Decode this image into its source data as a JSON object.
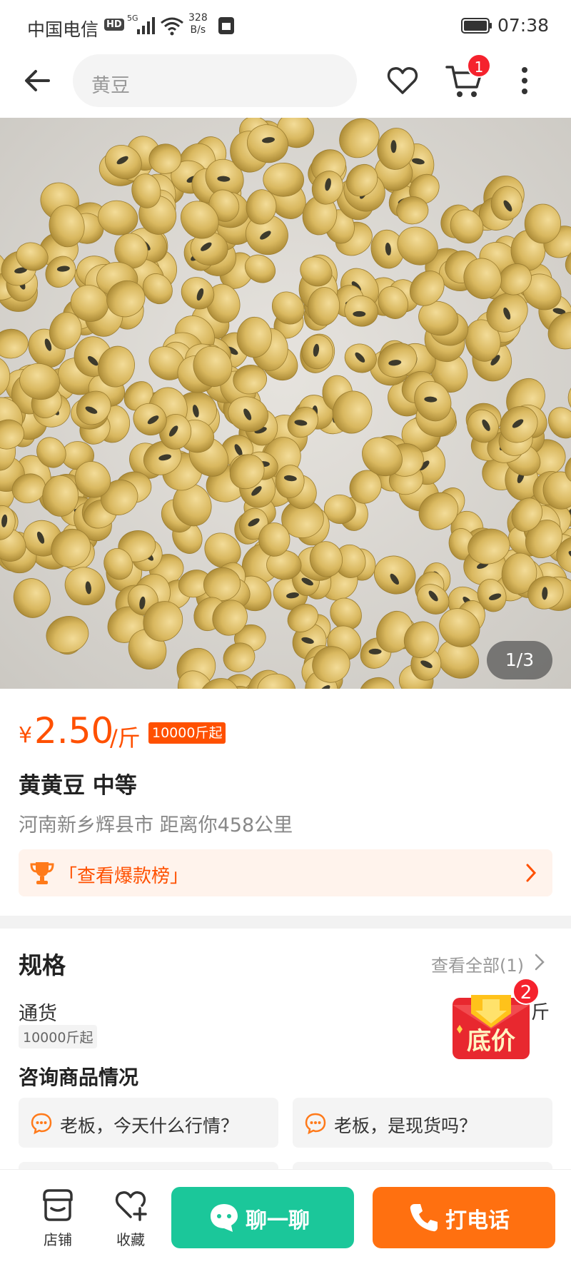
{
  "status_bar": {
    "carrier": "中国电信",
    "hd": "HD",
    "network": "5G",
    "speed_value": "328",
    "speed_unit": "B/s",
    "time": "07:38"
  },
  "nav": {
    "search_text": "黄豆",
    "cart_count": "1"
  },
  "photo": {
    "indicator": "1/3",
    "icon": "soybeans-photo"
  },
  "product": {
    "currency": "¥",
    "price": "2.50",
    "unit": "/斤",
    "moq": "10000斤起",
    "title": "黄黄豆 中等",
    "location": "河南新乡辉县市 距离你458公里",
    "hot_list": "「查看爆款榜」"
  },
  "specs": {
    "title": "规格",
    "view_all": "查看全部(1)",
    "item_name": "通货",
    "item_moq": "10000斤起",
    "item_unit": "斤",
    "lowprice_label": "底价",
    "lowprice_count": "2"
  },
  "consult": {
    "title": "咨询商品情况",
    "questions": [
      "老板，今天什么行情？",
      "老板，是现货吗？"
    ]
  },
  "bottom": {
    "store": "店铺",
    "favorite": "收藏",
    "chat": "聊一聊",
    "call": "打电话"
  },
  "colors": {
    "accent": "#ff5000",
    "chat_green": "#1bc79a",
    "call_orange": "#ff7010"
  }
}
